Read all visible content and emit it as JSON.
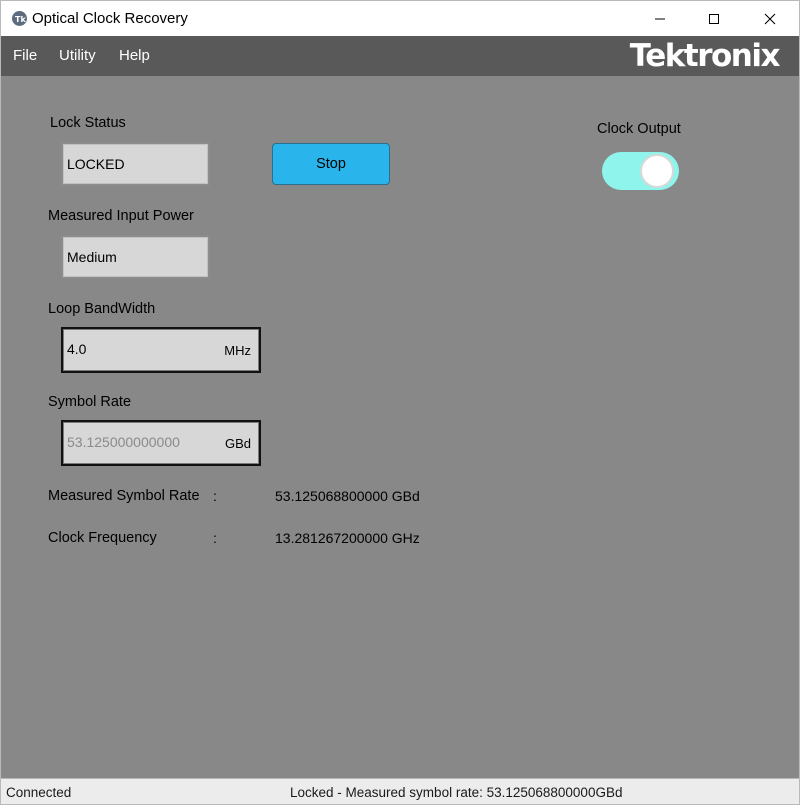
{
  "window": {
    "title": "Optical Clock Recovery"
  },
  "menu": {
    "file": "File",
    "utility": "Utility",
    "help": "Help",
    "brand": "Tektronix"
  },
  "lock_status": {
    "label": "Lock Status",
    "value": "LOCKED"
  },
  "stop_button": {
    "label": "Stop"
  },
  "clock_output": {
    "label": "Clock Output",
    "enabled": true
  },
  "input_power": {
    "label": "Measured Input Power",
    "value": "Medium"
  },
  "loop_bandwidth": {
    "label": "Loop BandWidth",
    "value": "4.0",
    "unit": "MHz"
  },
  "symbol_rate": {
    "label": "Symbol Rate",
    "value": "53.125000000000",
    "unit": "GBd"
  },
  "measured_symbol_rate": {
    "label": "Measured Symbol Rate",
    "separator": ":",
    "value": "53.125068800000 GBd"
  },
  "clock_frequency": {
    "label": "Clock Frequency",
    "separator": ":",
    "value": "13.281267200000 GHz"
  },
  "status_bar": {
    "connection": "Connected",
    "message": "Locked - Measured symbol rate: 53.125068800000GBd"
  },
  "colors": {
    "background": "#888888",
    "menubar": "#595959",
    "accent_button": "#29b4ec",
    "toggle_on": "#8ff5ec"
  }
}
